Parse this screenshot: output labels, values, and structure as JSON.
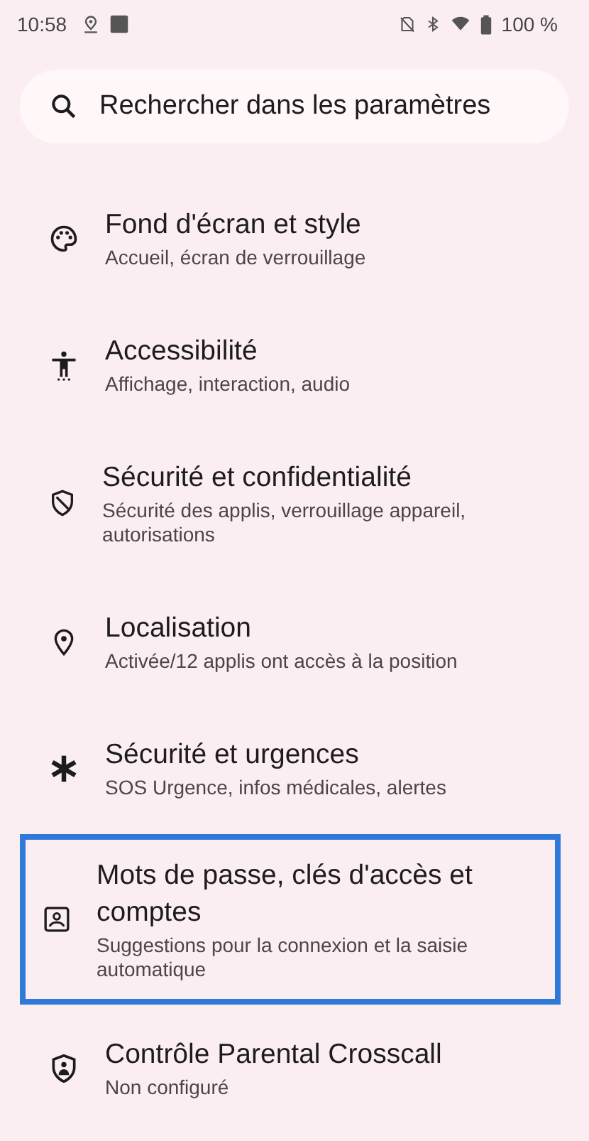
{
  "status_bar": {
    "time": "10:58",
    "battery": "100 %"
  },
  "search": {
    "placeholder": "Rechercher dans les paramètres"
  },
  "items": [
    {
      "kind": "palette",
      "title": "Fond d'écran et style",
      "subtitle": "Accueil, écran de verrouillage",
      "selected": false
    },
    {
      "kind": "accessibility",
      "title": "Accessibilité",
      "subtitle": "Affichage, interaction, audio",
      "selected": false
    },
    {
      "kind": "shield",
      "title": "Sécurité et confidentialité",
      "subtitle": "Sécurité des applis, verrouillage appareil, autorisations",
      "selected": false
    },
    {
      "kind": "location",
      "title": "Localisation",
      "subtitle": "Activée/12 applis ont accès à la position",
      "selected": false
    },
    {
      "kind": "emergency",
      "title": "Sécurité et urgences",
      "subtitle": "SOS Urgence, infos médicales, alertes",
      "selected": false
    },
    {
      "kind": "account",
      "title": "Mots de passe, clés d'accès et comptes",
      "subtitle": "Suggestions pour la connexion et la saisie automatique",
      "selected": true
    },
    {
      "kind": "parental",
      "title": "Contrôle Parental Crosscall",
      "subtitle": "Non configuré",
      "selected": false
    }
  ]
}
